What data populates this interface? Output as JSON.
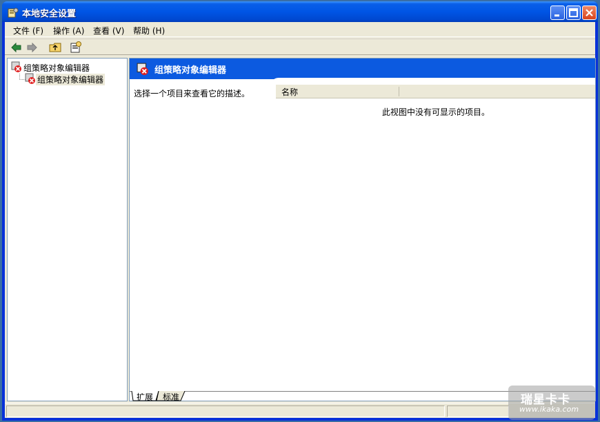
{
  "window": {
    "title": "本地安全设置"
  },
  "menu": [
    "文件 (F)",
    "操作 (A)",
    "查看 (V)",
    "帮助 (H)"
  ],
  "toolbar": {
    "icons": [
      "back-arrow-icon",
      "forward-arrow-icon",
      "up-folder-icon",
      "properties-icon"
    ]
  },
  "tree": {
    "root_label": "组策略对象编辑器",
    "child_label": "组策略对象编辑器"
  },
  "right_pane": {
    "banner_title": "组策略对象编辑器",
    "description": "选择一个项目来查看它的描述。",
    "column_name": "名称",
    "empty_message": "此视图中没有可显示的项目。",
    "tabs": [
      "扩展",
      "标准"
    ]
  },
  "watermark": {
    "title": "瑞星卡卡",
    "url": "www.ikaka.com"
  },
  "colors": {
    "title_bar": "#0055e5",
    "banner": "#0c5ae0",
    "frame": "#ece9d8"
  }
}
